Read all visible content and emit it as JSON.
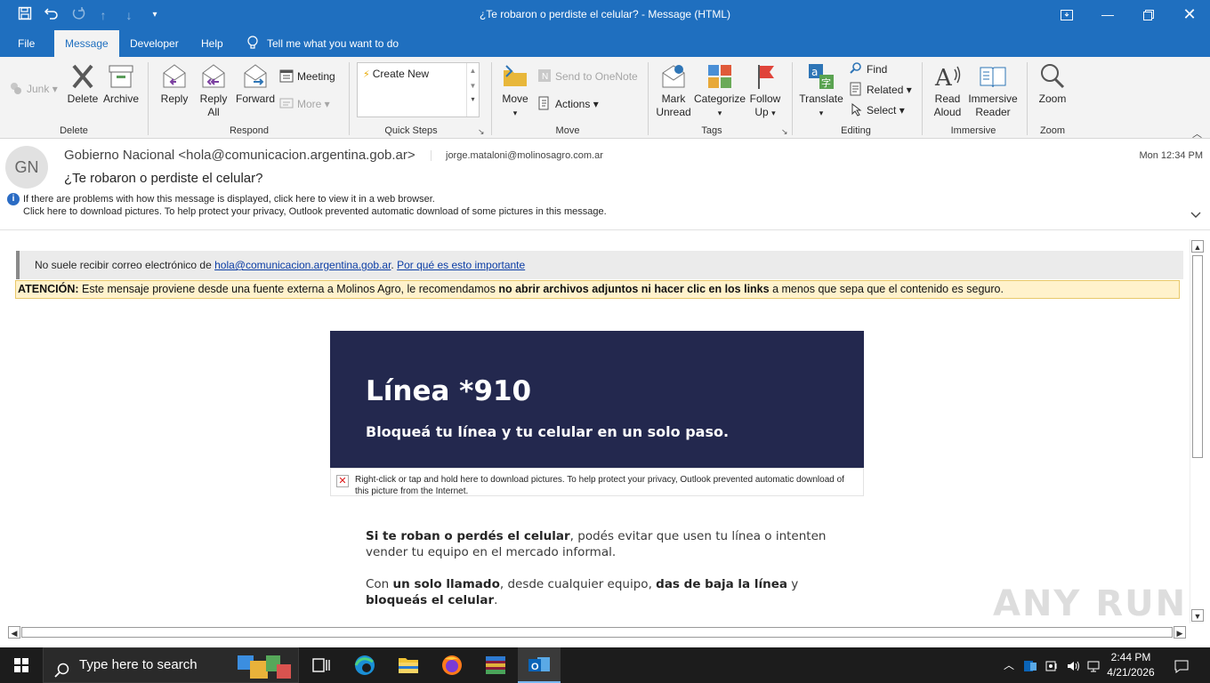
{
  "window": {
    "title": "¿Te robaron o perdiste el celular?  -  Message (HTML)"
  },
  "tabs": [
    "File",
    "Message",
    "Developer",
    "Help",
    "Tell me what you want to do"
  ],
  "ribbon": {
    "junk": "Junk",
    "delete": "Delete",
    "archive": "Archive",
    "reply": "Reply",
    "reply_all_1": "Reply",
    "reply_all_2": "All",
    "forward": "Forward",
    "meeting": "Meeting",
    "more": "More",
    "quick_steps_item": "Create New",
    "move": "Move",
    "send_onenote": "Send to OneNote",
    "actions": "Actions",
    "mark_unread_1": "Mark",
    "mark_unread_2": "Unread",
    "categorize": "Categorize",
    "follow_up_1": "Follow",
    "follow_up_2": "Up",
    "translate": "Translate",
    "find": "Find",
    "related": "Related",
    "select": "Select",
    "read_aloud_1": "Read",
    "read_aloud_2": "Aloud",
    "immersive_1": "Immersive",
    "immersive_2": "Reader",
    "zoom": "Zoom",
    "groups": {
      "delete": "Delete",
      "respond": "Respond",
      "quick_steps": "Quick Steps",
      "move": "Move",
      "tags": "Tags",
      "editing": "Editing",
      "immersive": "Immersive",
      "zoom": "Zoom"
    }
  },
  "message": {
    "avatar_initials": "GN",
    "sender": "Gobierno Nacional <hola@comunicacion.argentina.gob.ar>",
    "recipient": "jorge.mataloni@molinosagro.com.ar",
    "datetime": "Mon 12:34 PM",
    "subject": "¿Te robaron o perdiste el celular?",
    "info_line1": "If there are problems with how this message is displayed, click here to view it in a web browser.",
    "info_line2": "Click here to download pictures. To help protect your privacy, Outlook prevented automatic download of some pictures in this message."
  },
  "body": {
    "ext_prefix": "No suele recibir correo electrónico de ",
    "ext_link": "hola@comunicacion.argentina.gob.ar",
    "ext_sep": ". ",
    "ext_why": "Por qué es esto importante",
    "warn_label": "ATENCIÓN:",
    "warn_text1": " Este mensaje proviene desde una fuente externa a Molinos Agro, le recomendamos ",
    "warn_bold": "no abrir archivos adjuntos ni hacer clic en los links",
    "warn_text2": " a menos que sepa que el contenido es seguro.",
    "banner_title": "Línea *910",
    "banner_subtitle": "Bloqueá tu línea y tu celular en un solo paso.",
    "picture_notice": "Right-click or tap and hold here to download pictures. To help protect your privacy, Outlook prevented automatic download of this picture from the Internet.",
    "p1_bold": "Si te roban o perdés el celular",
    "p1_text": ", podés evitar que usen tu línea o intenten vender tu equipo en el mercado informal.",
    "p2_a": "Con ",
    "p2_b": "un solo llamado",
    "p2_c": ", desde cualquier equipo, ",
    "p2_d": "das de baja la línea",
    "p2_e": " y ",
    "p2_f": "bloqueás el celular",
    "p2_g": "."
  },
  "watermark": "ANY RUN",
  "taskbar": {
    "search_placeholder": "Type here to search",
    "time": "2:44 PM",
    "date": "4/21/2026"
  }
}
